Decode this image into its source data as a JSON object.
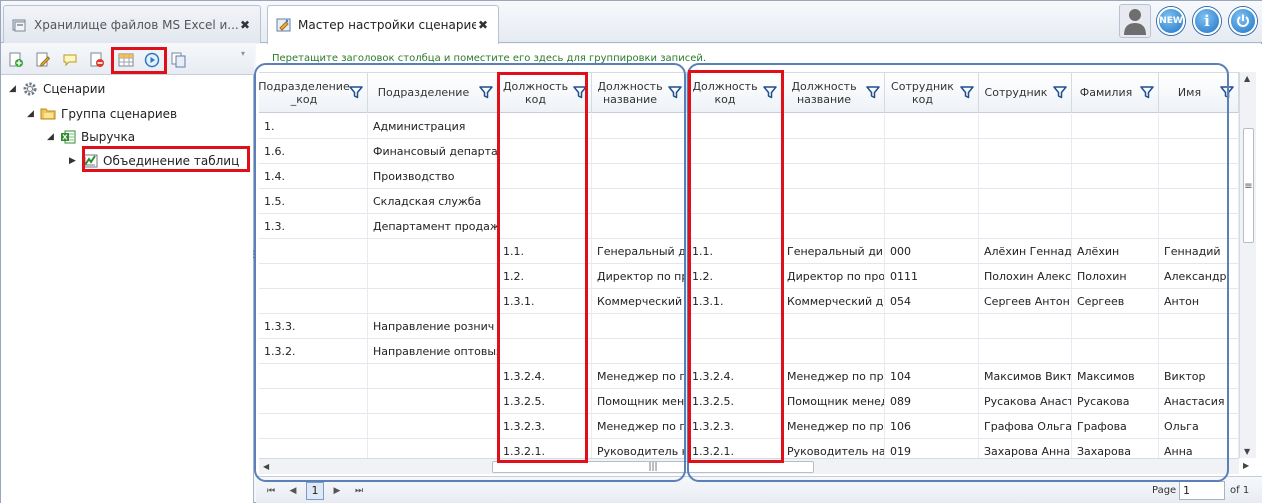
{
  "tabs": [
    {
      "label": "Хранилище файлов MS Excel и...",
      "icon": "storage-icon"
    },
    {
      "label": "Мастер настройки сценариев",
      "icon": "wizard-icon"
    }
  ],
  "top_icons": {
    "new_label": "NEW",
    "info_label": "i"
  },
  "tree": {
    "root": "Сценарии",
    "group": "Группа сценариев",
    "revenue": "Выручка",
    "merge": "Объединение таблиц"
  },
  "grid": {
    "hint": "Перетащите заголовок столбца и поместите его здесь для группировки записей.",
    "columns": [
      "Подразделение _код",
      "Подразделение",
      "Должность код",
      "Должность название",
      "Должность код",
      "Должность название",
      "Сотрудник код",
      "Сотрудник",
      "Фамилия",
      "Имя"
    ],
    "rows": [
      [
        "1.",
        "Администрация",
        "",
        "",
        "",
        "",
        "",
        "",
        "",
        ""
      ],
      [
        "1.6.",
        "Финансовый департам",
        "",
        "",
        "",
        "",
        "",
        "",
        "",
        ""
      ],
      [
        "1.4.",
        "Производство",
        "",
        "",
        "",
        "",
        "",
        "",
        "",
        ""
      ],
      [
        "1.5.",
        "Складская служба",
        "",
        "",
        "",
        "",
        "",
        "",
        "",
        ""
      ],
      [
        "1.3.",
        "Департамент продаж",
        "",
        "",
        "",
        "",
        "",
        "",
        "",
        ""
      ],
      [
        "",
        "",
        "1.1.",
        "Генеральный ди",
        "1.1.",
        "Генеральный дире",
        "000",
        "Алёхин Геннад",
        "Алёхин",
        "Геннадий"
      ],
      [
        "",
        "",
        "1.2.",
        "Директор по пр",
        "1.2.",
        "Директор по прои",
        "0111",
        "Полохин Алекс",
        "Полохин",
        "Александр"
      ],
      [
        "",
        "",
        "1.3.1.",
        "Коммерческий",
        "1.3.1.",
        "Коммерческий ди",
        "054",
        "Сергеев Антон",
        "Сергеев",
        "Антон"
      ],
      [
        "1.3.3.",
        "Направление рознич",
        "",
        "",
        "",
        "",
        "",
        "",
        "",
        ""
      ],
      [
        "1.3.2.",
        "Направление оптовых",
        "",
        "",
        "",
        "",
        "",
        "",
        "",
        ""
      ],
      [
        "",
        "",
        "1.3.2.4.",
        "Менеджер по п",
        "1.3.2.4.",
        "Менеджер по про",
        "104",
        "Максимов Викт",
        "Максимов",
        "Виктор"
      ],
      [
        "",
        "",
        "1.3.2.5.",
        "Помощник мен",
        "1.3.2.5.",
        "Помощник менед",
        "089",
        "Русакова Анаст",
        "Русакова",
        "Анастасия"
      ],
      [
        "",
        "",
        "1.3.2.3.",
        "Менеджер по п",
        "1.3.2.3.",
        "Менеджер по про",
        "106",
        "Графова Ольга",
        "Графова",
        "Ольга"
      ],
      [
        "",
        "",
        "1.3.2.1.",
        "Руководитель н",
        "1.3.2.1.",
        "Руководитель нап",
        "019",
        "Захарова Анна",
        "Захарова",
        "Анна"
      ]
    ]
  },
  "pager": {
    "current": "1",
    "page_label": "Page",
    "page_value": "1",
    "of_label": "of 1"
  },
  "colors": {
    "highlight_red": "#e0101a",
    "highlight_blue": "#5b7fb8",
    "hint_green": "#2b7a2b"
  }
}
